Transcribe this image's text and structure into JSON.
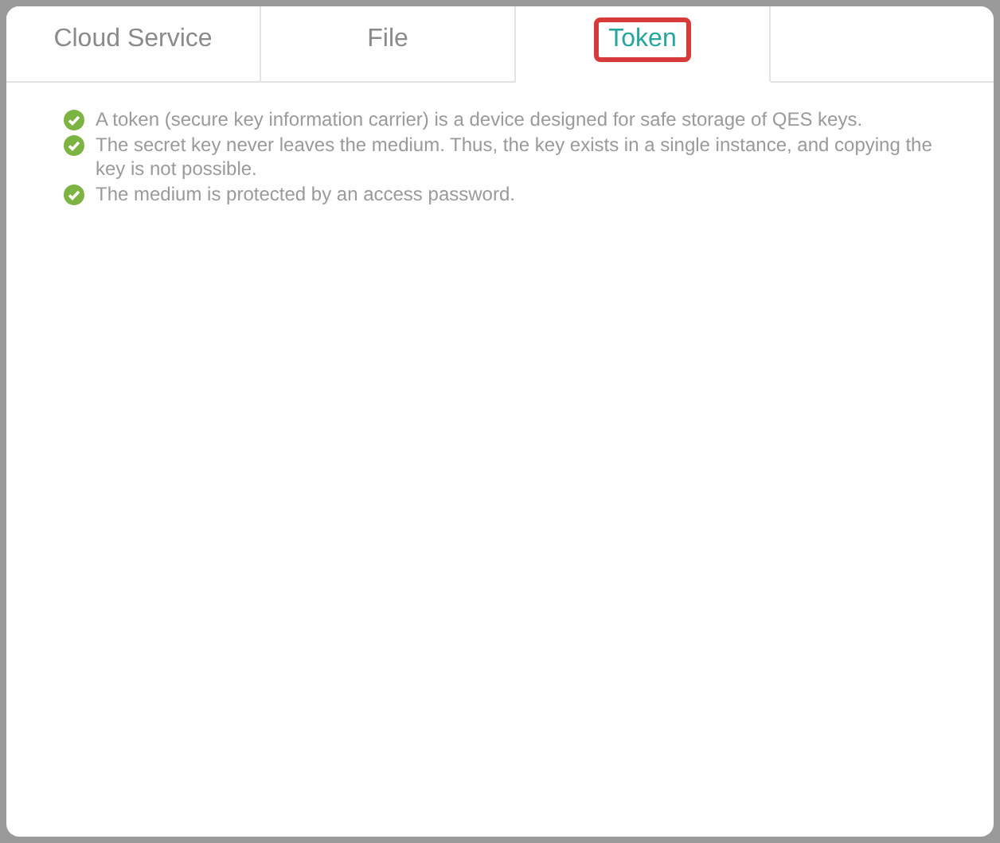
{
  "tabs": [
    {
      "label": "Cloud Service",
      "selected": false,
      "highlighted": false
    },
    {
      "label": "File",
      "selected": false,
      "highlighted": false
    },
    {
      "label": "Token",
      "selected": true,
      "highlighted": true
    }
  ],
  "features": [
    {
      "text": "A token (secure key information carrier) is a device designed for safe storage of QES keys.",
      "checked": true
    },
    {
      "text": "The secret key never leaves the medium. Thus, the key exists in a single instance, and copying the key is not possible.",
      "checked": true
    },
    {
      "text": "The medium is protected by an access password.",
      "checked": true
    }
  ]
}
